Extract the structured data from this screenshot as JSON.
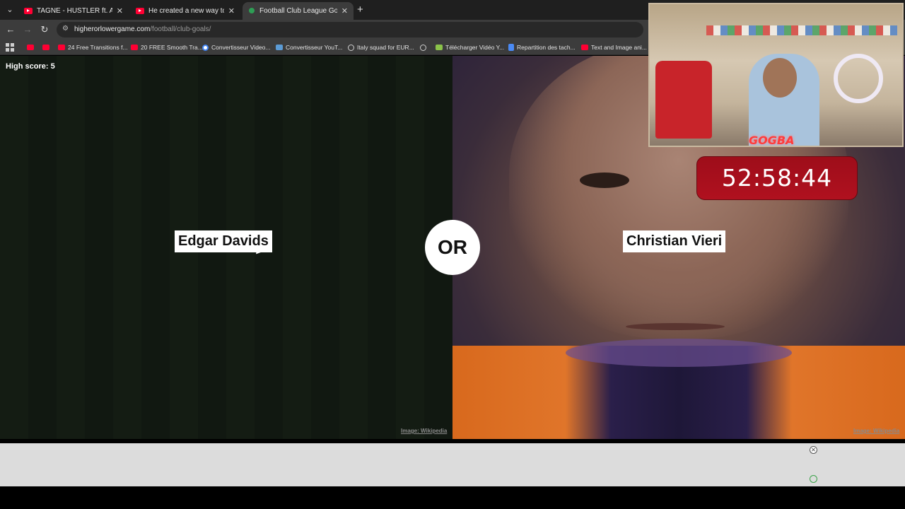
{
  "browser": {
    "tabs": [
      {
        "title": "TAGNE - HUSTLER ft. A.L.A (OFFI",
        "icon": "youtube-icon",
        "active": false
      },
      {
        "title": "He created a new way to surf th",
        "icon": "youtube-icon",
        "active": false
      },
      {
        "title": "Football Club League Goals Hig",
        "icon": "site-icon",
        "active": true
      }
    ],
    "tab_close": "✕",
    "new_tab": "+",
    "url_domain": "higherorlowergame.com",
    "url_path": "/football/club-goals/",
    "bookmarks": [
      {
        "label": "",
        "icon": "yt"
      },
      {
        "label": "",
        "icon": "yt"
      },
      {
        "label": "24 Free Transitions f...",
        "icon": "yt"
      },
      {
        "label": "20 FREE Smooth Tra...",
        "icon": "yt"
      },
      {
        "label": "Convertisseur Video...",
        "icon": "g"
      },
      {
        "label": "Convertisseur YouT...",
        "icon": "cv"
      },
      {
        "label": "Italy squad for EUR...",
        "icon": "globe"
      },
      {
        "label": "",
        "icon": "globe"
      },
      {
        "label": "Télécharger Vidéo Y...",
        "icon": "dl"
      },
      {
        "label": "Repartition des tach...",
        "icon": "doc"
      },
      {
        "label": "Text and Image ani...",
        "icon": "yt"
      }
    ]
  },
  "game": {
    "high_score": "High score: 5",
    "left_player": "Edgar Davids",
    "right_player": "Christian Vieri",
    "or_label": "OR",
    "left_credit": "Image: Wikipedia",
    "right_credit": "Image: Wikipedia"
  },
  "ad": {
    "close": "✕"
  },
  "overlay": {
    "timer": "52:58:44",
    "logo": "GOGBA"
  },
  "colors": {
    "timer_red": "#b0111f",
    "jersey_orange": "#e0752a",
    "pitch_green": "#141c13"
  }
}
